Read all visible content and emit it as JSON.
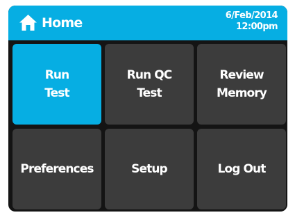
{
  "header": {
    "title": "Home",
    "date": "6/Feb/2014",
    "time": "12:00pm",
    "icon": "home-icon"
  },
  "colors": {
    "accent": "#06aee3",
    "tile": "#3c3c3c",
    "frame": "#141414",
    "text": "#ffffff"
  },
  "menu": {
    "tiles": [
      {
        "label": "Run\nTest",
        "active": true
      },
      {
        "label": "Run QC\nTest",
        "active": false
      },
      {
        "label": "Review\nMemory",
        "active": false
      },
      {
        "label": "Preferences",
        "active": false
      },
      {
        "label": "Setup",
        "active": false
      },
      {
        "label": "Log Out",
        "active": false
      }
    ]
  }
}
